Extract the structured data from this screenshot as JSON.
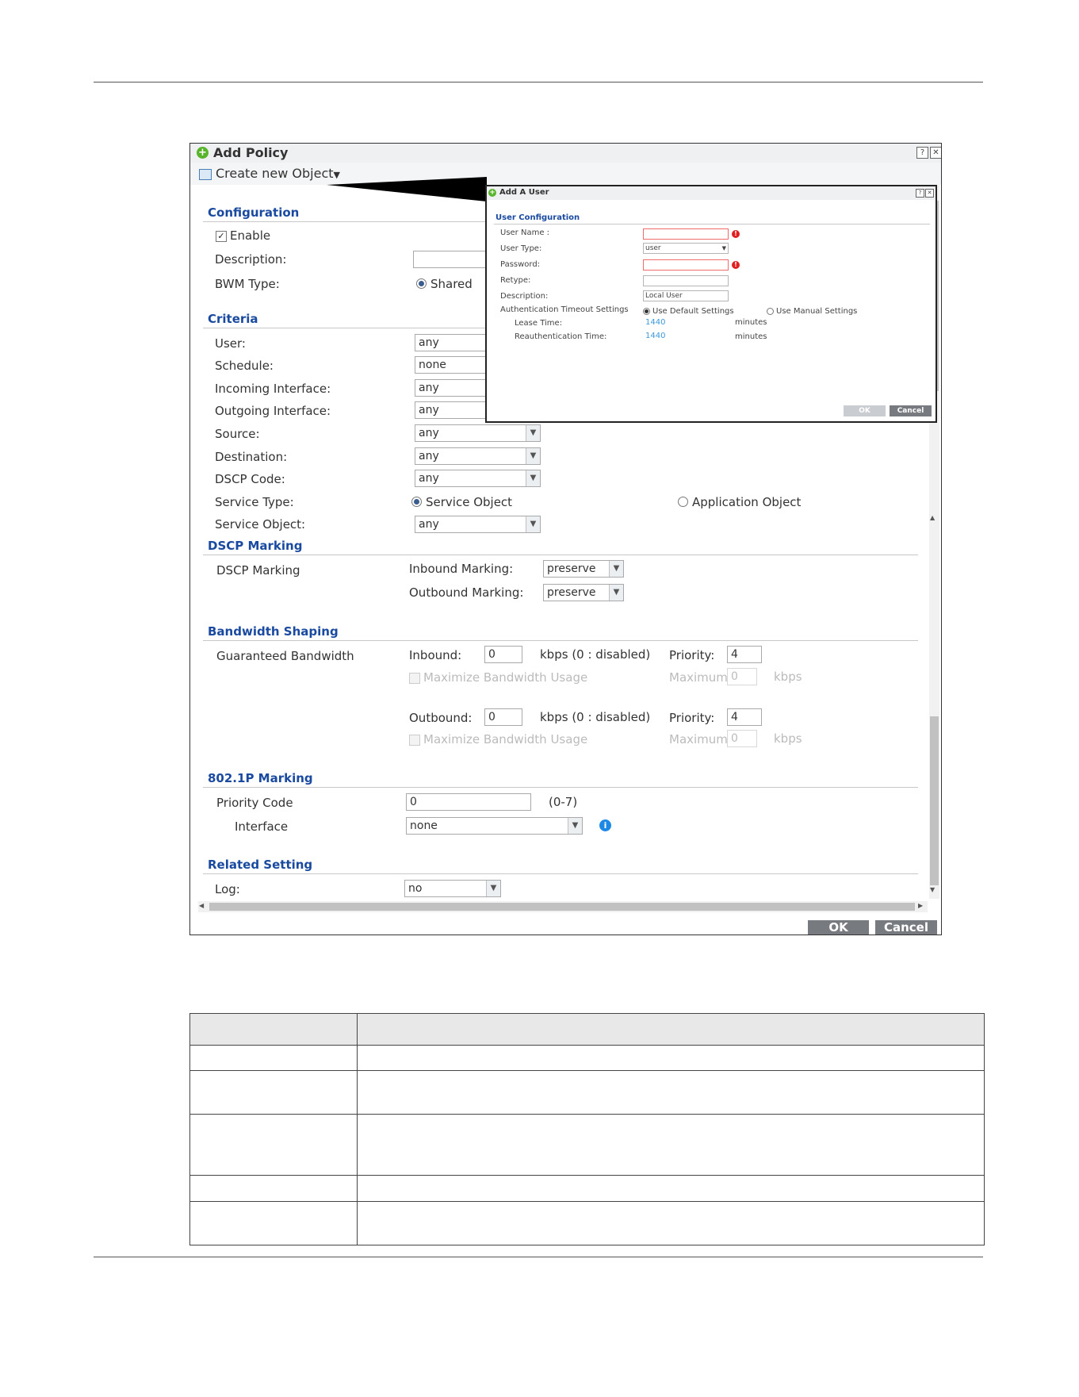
{
  "dialog": {
    "title": "Add Policy",
    "help_glyph": "?",
    "close_glyph": "✕",
    "toolbar_label": "Create new Object",
    "toolbar_caret": "▼",
    "sections": {
      "configuration": "Configuration",
      "criteria": "Criteria",
      "dscp_marking": "DSCP Marking",
      "bandwidth_shaping": "Bandwidth Shaping",
      "p8021_marking": "802.1P Marking",
      "related_setting": "Related Setting"
    },
    "config": {
      "enable_label": "Enable",
      "enable_mark": "✓",
      "description_label": "Description:",
      "description_value": "",
      "bwm_type_label": "BWM Type:",
      "bwm_type_value": "Shared"
    },
    "criteria": {
      "user_label": "User:",
      "user_value": "any",
      "schedule_label": "Schedule:",
      "schedule_value": "none",
      "incoming_label": "Incoming Interface:",
      "incoming_value": "any",
      "outgoing_label": "Outgoing Interface:",
      "outgoing_value": "any",
      "source_label": "Source:",
      "source_value": "any",
      "destination_label": "Destination:",
      "destination_value": "any",
      "dscp_code_label": "DSCP Code:",
      "dscp_code_value": "any",
      "service_type_label": "Service Type:",
      "service_type_opt1": "Service Object",
      "service_type_opt2": "Application Object",
      "service_object_label": "Service Object:",
      "service_object_value": "any"
    },
    "dscp": {
      "row_label": "DSCP Marking",
      "inbound_label": "Inbound Marking:",
      "inbound_value": "preserve",
      "outbound_label": "Outbound Marking:",
      "outbound_value": "preserve"
    },
    "bandwidth": {
      "row_label": "Guaranteed Bandwidth",
      "inbound_label": "Inbound:",
      "inbound_value": "0",
      "kbps_disabled": "kbps (0 : disabled)",
      "priority_label": "Priority:",
      "inbound_priority": "4",
      "maximize_label": "Maximize Bandwidth Usage",
      "maximum_label": "Maximum:",
      "maximum_value": "0",
      "kbps": "kbps",
      "outbound_label": "Outbound:",
      "outbound_value": "0",
      "outbound_priority": "4"
    },
    "p8021": {
      "priority_code_label": "Priority Code",
      "priority_code_value": "0",
      "priority_code_range": "(0-7)",
      "interface_label": "Interface",
      "interface_value": "none",
      "info_glyph": "i"
    },
    "related": {
      "log_label": "Log:",
      "log_value": "no"
    },
    "ok_label": "OK",
    "cancel_label": "Cancel"
  },
  "sub_dialog": {
    "title": "Add A User",
    "help_glyph": "?",
    "close_glyph": "✕",
    "section": "User Configuration",
    "user_name_label": "User Name :",
    "user_type_label": "User Type:",
    "user_type_value": "user",
    "password_label": "Password:",
    "retype_label": "Retype:",
    "description_label": "Description:",
    "description_value": "Local User",
    "auth_timeout_label": "Authentication Timeout Settings",
    "default_settings": "Use Default Settings",
    "manual_settings": "Use Manual Settings",
    "lease_time_label": "Lease Time:",
    "lease_time_value": "1440",
    "reauth_time_label": "Reauthentication Time:",
    "reauth_time_value": "1440",
    "minutes": "minutes",
    "warn_glyph": "!",
    "ok_label": "OK",
    "cancel_label": "Cancel"
  },
  "colors": {
    "section_title": "#1a4aa0",
    "add_icon": "#58b52b",
    "info_icon": "#1e88e5",
    "required_border": "#f06b6b"
  }
}
